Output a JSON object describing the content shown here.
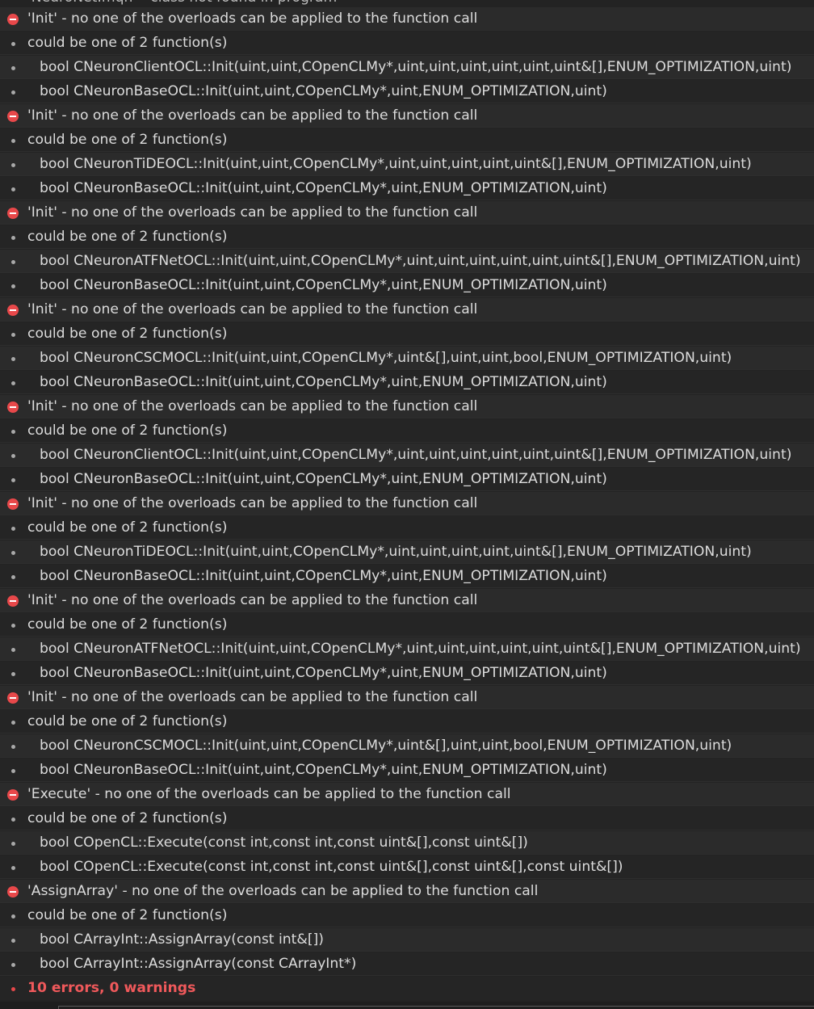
{
  "partial_top_line": "'NeuroNet.mqh' - class not found in program",
  "rows": [
    {
      "kind": "error",
      "text": "'Init' - no one of the overloads can be applied to the function call"
    },
    {
      "kind": "info",
      "text": "could be one of 2 function(s)"
    },
    {
      "kind": "detail",
      "text": "bool CNeuronClientOCL::Init(uint,uint,COpenCLMy*,uint,uint,uint,uint,uint,uint&[],ENUM_OPTIMIZATION,uint)"
    },
    {
      "kind": "detail",
      "text": "bool CNeuronBaseOCL::Init(uint,uint,COpenCLMy*,uint,ENUM_OPTIMIZATION,uint)"
    },
    {
      "kind": "error",
      "text": "'Init' - no one of the overloads can be applied to the function call"
    },
    {
      "kind": "info",
      "text": "could be one of 2 function(s)"
    },
    {
      "kind": "detail",
      "text": "bool CNeuronTiDEOCL::Init(uint,uint,COpenCLMy*,uint,uint,uint,uint,uint&[],ENUM_OPTIMIZATION,uint)"
    },
    {
      "kind": "detail",
      "text": "bool CNeuronBaseOCL::Init(uint,uint,COpenCLMy*,uint,ENUM_OPTIMIZATION,uint)"
    },
    {
      "kind": "error",
      "text": "'Init' - no one of the overloads can be applied to the function call"
    },
    {
      "kind": "info",
      "text": "could be one of 2 function(s)"
    },
    {
      "kind": "detail",
      "text": "bool CNeuronATFNetOCL::Init(uint,uint,COpenCLMy*,uint,uint,uint,uint,uint,uint&[],ENUM_OPTIMIZATION,uint)"
    },
    {
      "kind": "detail",
      "text": "bool CNeuronBaseOCL::Init(uint,uint,COpenCLMy*,uint,ENUM_OPTIMIZATION,uint)"
    },
    {
      "kind": "error",
      "text": "'Init' - no one of the overloads can be applied to the function call"
    },
    {
      "kind": "info",
      "text": "could be one of 2 function(s)"
    },
    {
      "kind": "detail",
      "text": "bool CNeuronCSCMOCL::Init(uint,uint,COpenCLMy*,uint&[],uint,uint,bool,ENUM_OPTIMIZATION,uint)"
    },
    {
      "kind": "detail",
      "text": "bool CNeuronBaseOCL::Init(uint,uint,COpenCLMy*,uint,ENUM_OPTIMIZATION,uint)"
    },
    {
      "kind": "error",
      "text": "'Init' - no one of the overloads can be applied to the function call"
    },
    {
      "kind": "info",
      "text": "could be one of 2 function(s)"
    },
    {
      "kind": "detail",
      "text": "bool CNeuronClientOCL::Init(uint,uint,COpenCLMy*,uint,uint,uint,uint,uint,uint&[],ENUM_OPTIMIZATION,uint)"
    },
    {
      "kind": "detail",
      "text": "bool CNeuronBaseOCL::Init(uint,uint,COpenCLMy*,uint,ENUM_OPTIMIZATION,uint)"
    },
    {
      "kind": "error",
      "text": "'Init' - no one of the overloads can be applied to the function call"
    },
    {
      "kind": "info",
      "text": "could be one of 2 function(s)"
    },
    {
      "kind": "detail",
      "text": "bool CNeuronTiDEOCL::Init(uint,uint,COpenCLMy*,uint,uint,uint,uint,uint&[],ENUM_OPTIMIZATION,uint)"
    },
    {
      "kind": "detail",
      "text": "bool CNeuronBaseOCL::Init(uint,uint,COpenCLMy*,uint,ENUM_OPTIMIZATION,uint)"
    },
    {
      "kind": "error",
      "text": "'Init' - no one of the overloads can be applied to the function call"
    },
    {
      "kind": "info",
      "text": "could be one of 2 function(s)"
    },
    {
      "kind": "detail",
      "text": "bool CNeuronATFNetOCL::Init(uint,uint,COpenCLMy*,uint,uint,uint,uint,uint,uint&[],ENUM_OPTIMIZATION,uint)"
    },
    {
      "kind": "detail",
      "text": "bool CNeuronBaseOCL::Init(uint,uint,COpenCLMy*,uint,ENUM_OPTIMIZATION,uint)"
    },
    {
      "kind": "error",
      "text": "'Init' - no one of the overloads can be applied to the function call"
    },
    {
      "kind": "info",
      "text": "could be one of 2 function(s)"
    },
    {
      "kind": "detail",
      "text": "bool CNeuronCSCMOCL::Init(uint,uint,COpenCLMy*,uint&[],uint,uint,bool,ENUM_OPTIMIZATION,uint)"
    },
    {
      "kind": "detail",
      "text": "bool CNeuronBaseOCL::Init(uint,uint,COpenCLMy*,uint,ENUM_OPTIMIZATION,uint)"
    },
    {
      "kind": "error",
      "text": "'Execute' - no one of the overloads can be applied to the function call"
    },
    {
      "kind": "info",
      "text": "could be one of 2 function(s)"
    },
    {
      "kind": "detail",
      "text": "bool COpenCL::Execute(const int,const int,const uint&[],const uint&[])"
    },
    {
      "kind": "detail",
      "text": "bool COpenCL::Execute(const int,const int,const uint&[],const uint&[],const uint&[])"
    },
    {
      "kind": "error",
      "text": "'AssignArray' - no one of the overloads can be applied to the function call"
    },
    {
      "kind": "info",
      "text": "could be one of 2 function(s)"
    },
    {
      "kind": "detail",
      "text": "bool CArrayInt::AssignArray(const int&[])"
    },
    {
      "kind": "detail",
      "text": "bool CArrayInt::AssignArray(const CArrayInt*)"
    }
  ],
  "summary": "10 errors, 0 warnings",
  "colors": {
    "background": "#232323",
    "error_icon": "#e8484a",
    "summary_text": "#f0595b",
    "text": "#dcdcdc"
  },
  "icons": {
    "error": "error-circle-icon",
    "info": "bullet-icon",
    "detail": "bullet-icon"
  }
}
